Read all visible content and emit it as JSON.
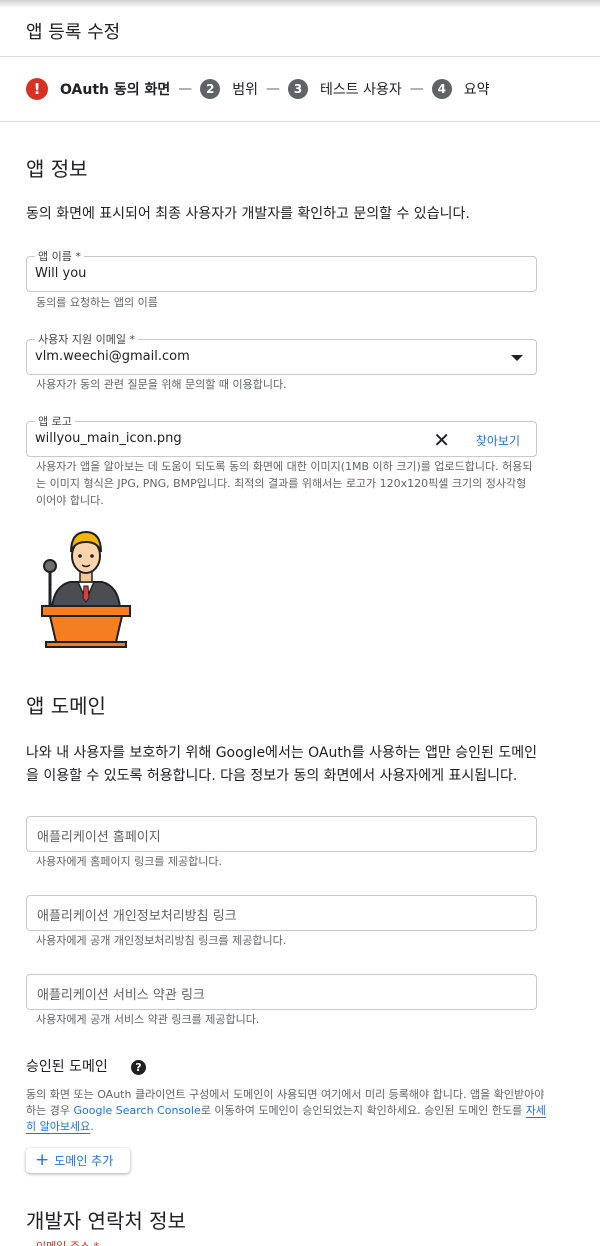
{
  "page": {
    "title": "앱 등록 수정"
  },
  "stepper": {
    "active": {
      "label": "OAuth 동의 화면",
      "icon": "error-icon",
      "icon_glyph": "!"
    },
    "separator": "—",
    "steps": [
      {
        "number": "2",
        "label": "범위"
      },
      {
        "number": "3",
        "label": "테스트 사용자"
      },
      {
        "number": "4",
        "label": "요약"
      }
    ]
  },
  "app_info": {
    "title": "앱 정보",
    "description": "동의 화면에 표시되어 최종 사용자가 개발자를 확인하고 문의할 수 있습니다.",
    "app_name": {
      "label": "앱 이름 *",
      "value": "Will you",
      "hint": "동의를 요청하는 앱의 이름"
    },
    "support_email": {
      "label": "사용자 지원 이메일 *",
      "value": "vlm.weechi@gmail.com",
      "hint": "사용자가 동의 관련 질문을 위해 문의할 때 이용합니다."
    },
    "app_logo": {
      "label": "앱 로고",
      "value": "willyou_main_icon.png",
      "clear_glyph": "✕",
      "browse_label": "찾아보기",
      "hint": "사용자가 앱을 알아보는 데 도움이 되도록 동의 화면에 대한 이미지(1MB 이하 크기)를 업로드합니다. 허용되는 이미지 형식은 JPG, PNG, BMP입니다. 최적의 결과를 위해서는 로고가 120x120픽셀 크기의 정사각형이어야 합니다."
    }
  },
  "app_domain": {
    "title": "앱 도메인",
    "description": "나와 내 사용자를 보호하기 위해 Google에서는 OAuth를 사용하는 앱만 승인된 도메인을 이용할 수 있도록 허용합니다. 다음 정보가 동의 화면에서 사용자에게 표시됩니다.",
    "homepage": {
      "placeholder": "애플리케이션 홈페이지",
      "hint": "사용자에게 홈페이지 링크를 제공합니다."
    },
    "privacy": {
      "placeholder": "애플리케이션 개인정보처리방침 링크",
      "hint": "사용자에게 공개 개인정보처리방침 링크를 제공합니다."
    },
    "terms": {
      "placeholder": "애플리케이션 서비스 약관 링크",
      "hint": "사용자에게 공개 서비스 약관 링크를 제공합니다."
    }
  },
  "authorized_domains": {
    "title": "승인된 도메인",
    "help_glyph": "?",
    "text_1": "동의 화면 또는 OAuth 클라이언트 구성에서 도메인이 사용되면 여기에서 미리 등록해야 합니다. 앱을 확인받아야 하는 경우 ",
    "link_1": "Google Search Console",
    "text_2": "로 이동하여 도메인이 승인되었는지 확인하세요. 승인된 도메인 한도를 ",
    "link_2": "자세히 알아보세요",
    "text_3": ".",
    "add_button": {
      "icon": "+",
      "label": "도메인 추가"
    }
  },
  "developer_contact": {
    "title": "개발자 연락처 정보",
    "email_label": "이메일 주소 *"
  },
  "colors": {
    "accent": "#1a73e8",
    "error": "#d93025",
    "logo_orange": "#f57f20"
  }
}
